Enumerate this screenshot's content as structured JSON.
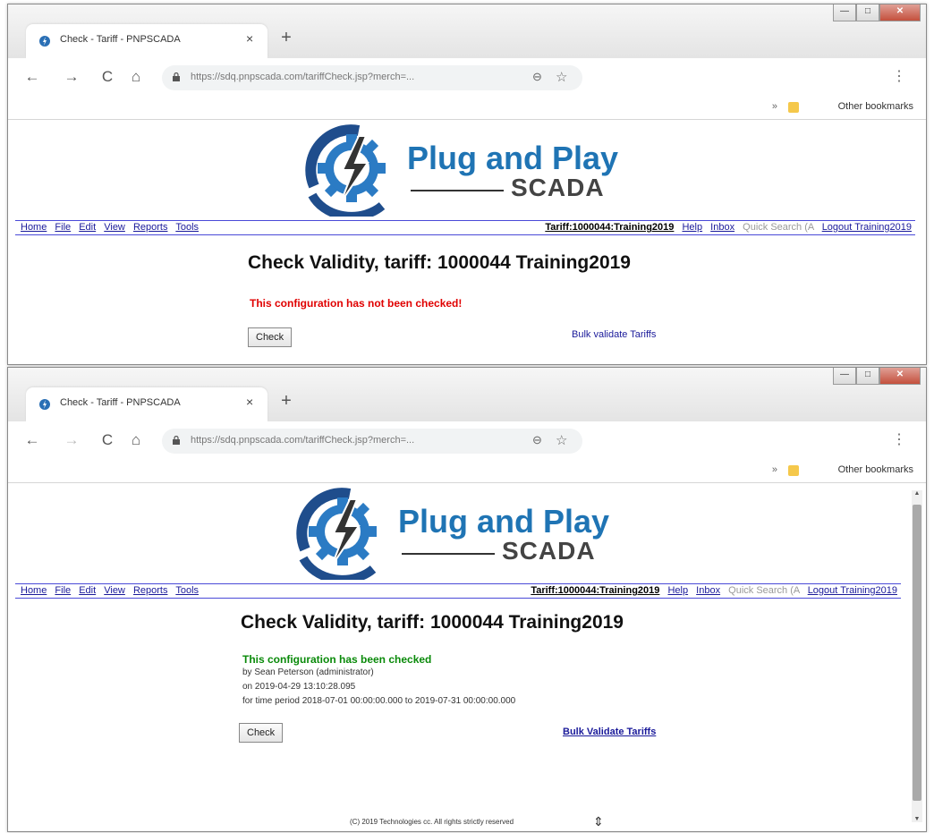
{
  "windows": [
    {
      "tab": {
        "title": "Check - Tariff - PNPSCADA",
        "close": "×"
      },
      "new_tab": "+",
      "controls": {
        "min": "—",
        "max": "□",
        "close": "✕"
      },
      "nav": {
        "back": "←",
        "forward": "→",
        "reload": "C",
        "home": "⌂"
      },
      "address": {
        "url": "https://sdq.pnpscada.com/tariffCheck.jsp?merch=...",
        "zoom_icon": "⊖",
        "star_icon": "☆"
      },
      "menu_icon": "⋮",
      "bookmarks": {
        "more": "»",
        "other": "Other bookmarks"
      },
      "logo": {
        "line1": "Plug and Play",
        "line2": "SCADA"
      },
      "menubar": {
        "left": [
          "Home",
          "File",
          "Edit",
          "View",
          "Reports",
          "Tools"
        ],
        "tariff": "Tariff:1000044:Training2019",
        "help": "Help",
        "inbox": "Inbox",
        "quick_search": "Quick Search (A",
        "logout": "Logout Training2019"
      },
      "heading": "Check Validity, tariff: 1000044 Training2019",
      "status": "This configuration has not been checked!",
      "check_button": "Check",
      "bulk_link": "Bulk validate Tariffs"
    },
    {
      "tab": {
        "title": "Check - Tariff - PNPSCADA",
        "close": "×"
      },
      "new_tab": "+",
      "controls": {
        "min": "—",
        "max": "□",
        "close": "✕"
      },
      "nav": {
        "back": "←",
        "forward": "→",
        "reload": "C",
        "home": "⌂"
      },
      "address": {
        "url": "https://sdq.pnpscada.com/tariffCheck.jsp?merch=...",
        "zoom_icon": "⊖",
        "star_icon": "☆"
      },
      "menu_icon": "⋮",
      "bookmarks": {
        "more": "»",
        "other": "Other bookmarks"
      },
      "logo": {
        "line1": "Plug and Play",
        "line2": "SCADA"
      },
      "menubar": {
        "left": [
          "Home",
          "File",
          "Edit",
          "View",
          "Reports",
          "Tools"
        ],
        "tariff": "Tariff:1000044:Training2019",
        "help": "Help",
        "inbox": "Inbox",
        "quick_search": "Quick Search (A",
        "logout": "Logout Training2019"
      },
      "heading": "Check Validity, tariff: 1000044 Training2019",
      "status": "This configuration has been checked",
      "details": [
        "by Sean Peterson (administrator)",
        "on 2019-04-29 13:10:28.095",
        "for time period 2018-07-01 00:00:00.000 to 2019-07-31 00:00:00.000"
      ],
      "check_button": "Check",
      "bulk_link": "Bulk Validate Tariffs",
      "footer": "(C) 2019 Technologies cc. All rights strictly reserved",
      "scroll": {
        "up": "▲",
        "down": "▼"
      }
    }
  ],
  "colors": {
    "brand_blue": "#1f74b4",
    "link": "#1a1a9a",
    "error": "#e00000",
    "success": "#0a8a0a"
  }
}
